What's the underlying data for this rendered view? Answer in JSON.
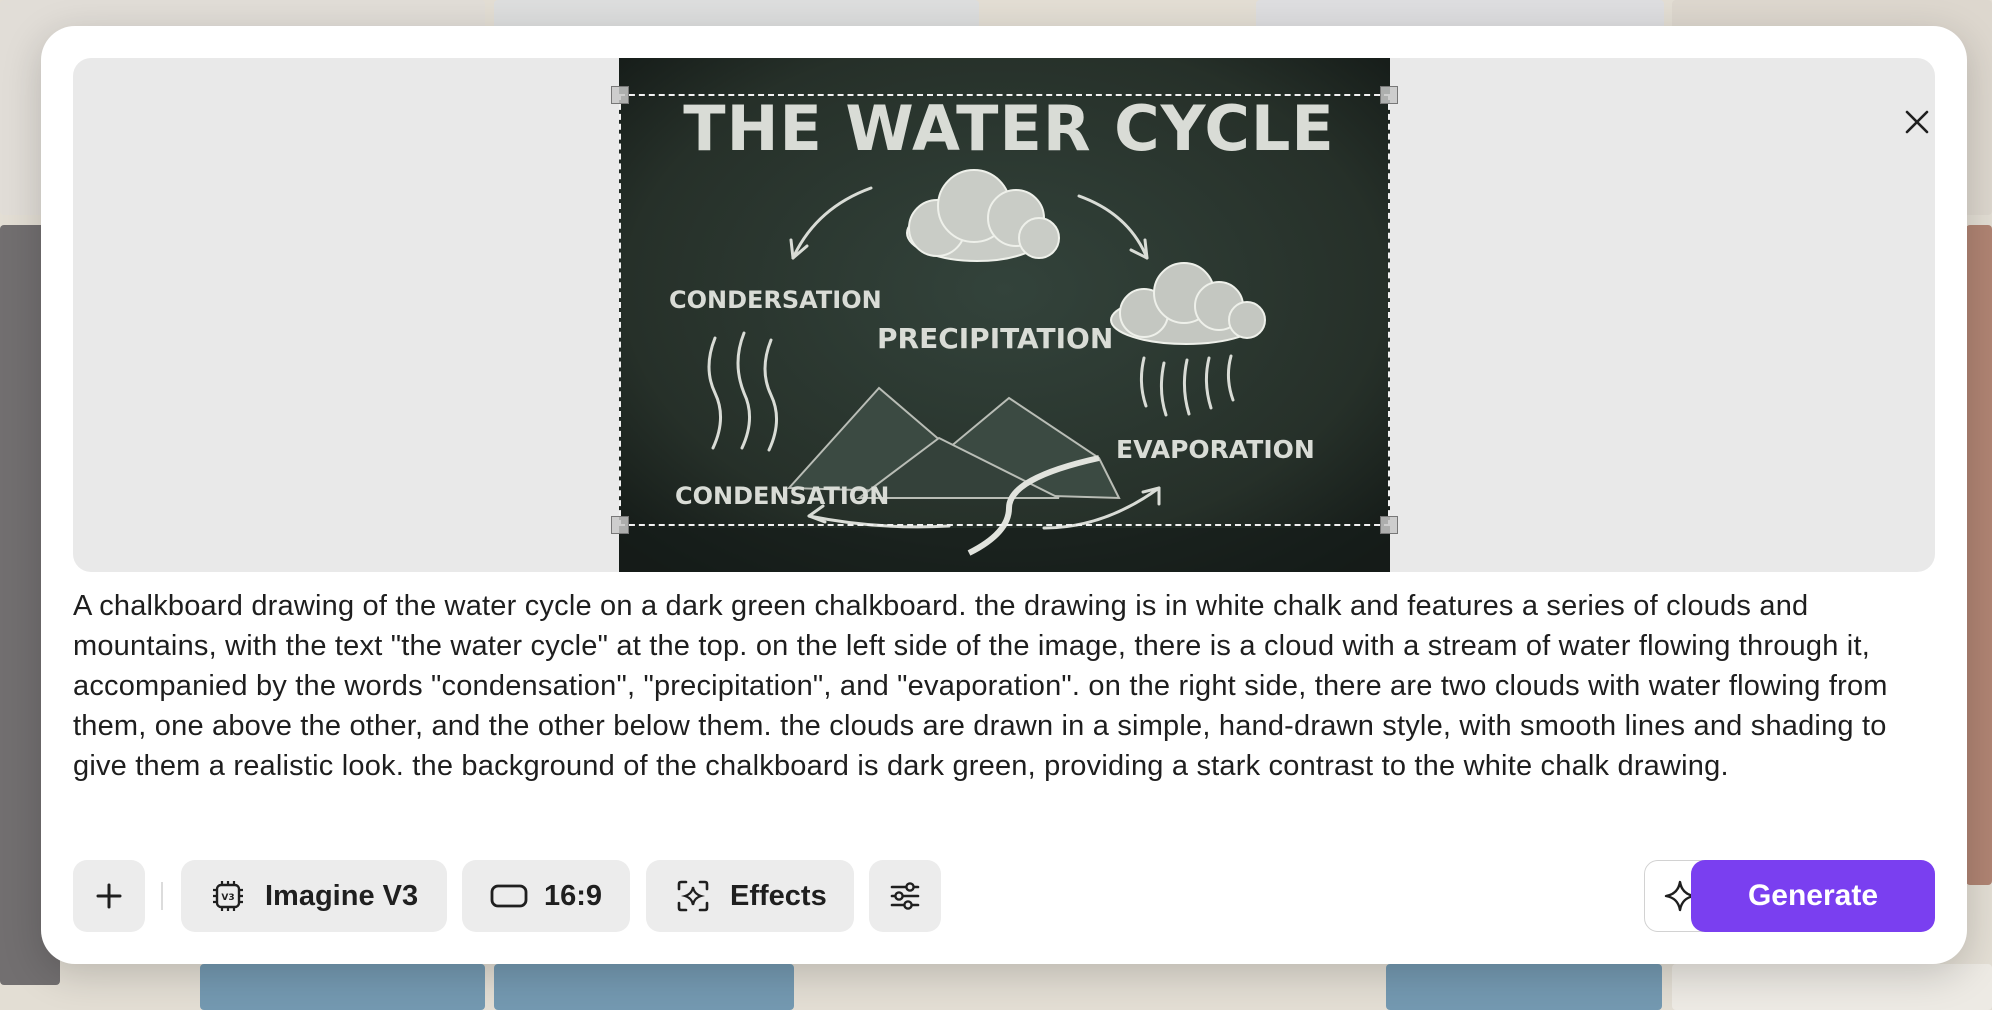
{
  "preview": {
    "image_title": "THE WATER CYCLE",
    "labels": {
      "condensation_top": "CONDERSATION",
      "precipitation": "PRECIPITATION",
      "condensation_bottom": "CONDENSATION",
      "evaporation": "EVAPORATION"
    }
  },
  "prompt": {
    "text": "A chalkboard drawing of the water cycle on a dark green chalkboard. the drawing is in white chalk and features a series of clouds and mountains, with the text \"the water cycle\" at the top. on the left side of the image, there is a cloud with a stream of water flowing through it, accompanied by the words \"condensation\", \"precipitation\", and \"evaporation\". on the right side, there are two clouds with water flowing from them, one above the other, and the other below them. the clouds are drawn in a simple, hand-drawn style, with smooth lines and shading to give them a realistic look. the background of the chalkboard is dark green, providing a stark contrast to the white chalk drawing."
  },
  "toolbar": {
    "model_label": "Imagine V3",
    "model_badge": "V3",
    "aspect_label": "16:9",
    "effects_label": "Effects",
    "generate_label": "Generate"
  },
  "icons": {
    "add": "plus-icon",
    "model": "chip-icon",
    "aspect": "rectangle-icon",
    "effects": "focus-sparkle-icon",
    "settings": "sliders-icon",
    "enhance": "sparkle-icon",
    "close": "close-icon"
  },
  "colors": {
    "accent": "#7a3ff0",
    "chalkboard": "#27332d",
    "chalk": "#d9dcd6",
    "pane": "#e9e9e9",
    "button": "#ececec"
  }
}
